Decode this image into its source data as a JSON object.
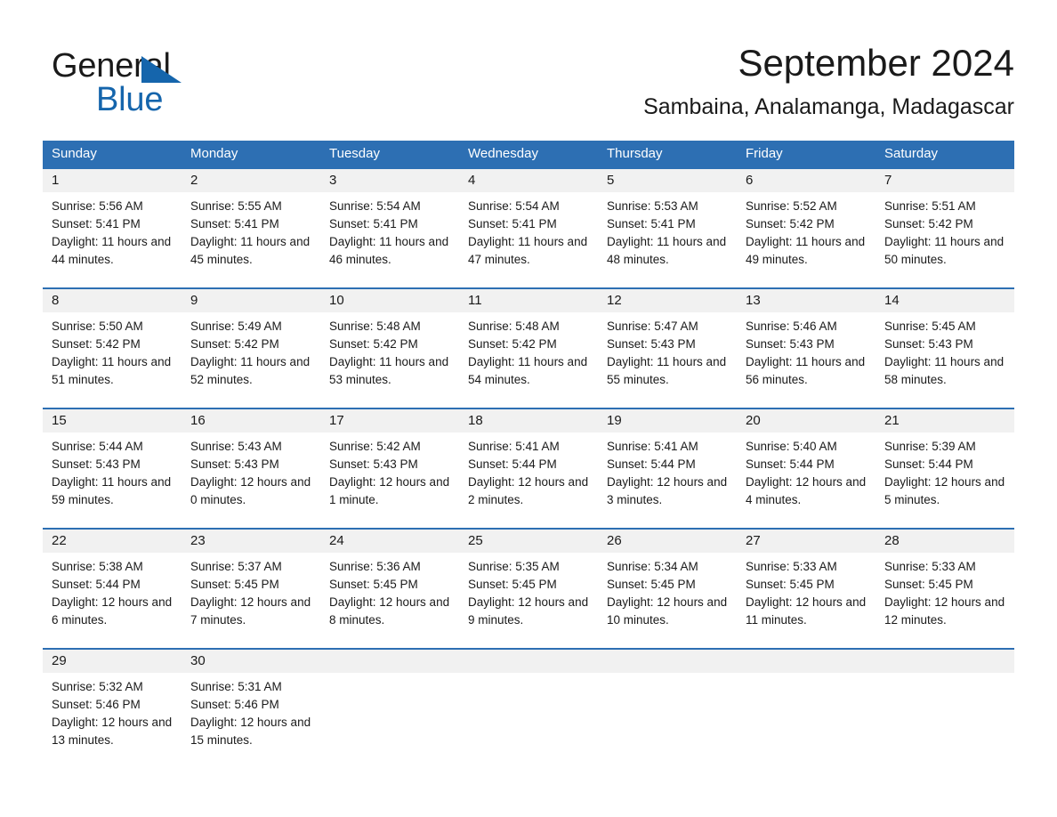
{
  "brand": {
    "name_dark": "General",
    "name_blue": "Blue",
    "logo_color": "#1565ac"
  },
  "header": {
    "title": "September 2024",
    "subtitle": "Sambaina, Analamanga, Madagascar"
  },
  "theme": {
    "accent": "#2d6fb3",
    "daynum_band": "#f1f1f1",
    "text": "#1a1a1a"
  },
  "weekdays": [
    "Sunday",
    "Monday",
    "Tuesday",
    "Wednesday",
    "Thursday",
    "Friday",
    "Saturday"
  ],
  "weeks": [
    [
      {
        "day": "1",
        "sunrise": "Sunrise: 5:56 AM",
        "sunset": "Sunset: 5:41 PM",
        "daylight": "Daylight: 11 hours and 44 minutes."
      },
      {
        "day": "2",
        "sunrise": "Sunrise: 5:55 AM",
        "sunset": "Sunset: 5:41 PM",
        "daylight": "Daylight: 11 hours and 45 minutes."
      },
      {
        "day": "3",
        "sunrise": "Sunrise: 5:54 AM",
        "sunset": "Sunset: 5:41 PM",
        "daylight": "Daylight: 11 hours and 46 minutes."
      },
      {
        "day": "4",
        "sunrise": "Sunrise: 5:54 AM",
        "sunset": "Sunset: 5:41 PM",
        "daylight": "Daylight: 11 hours and 47 minutes."
      },
      {
        "day": "5",
        "sunrise": "Sunrise: 5:53 AM",
        "sunset": "Sunset: 5:41 PM",
        "daylight": "Daylight: 11 hours and 48 minutes."
      },
      {
        "day": "6",
        "sunrise": "Sunrise: 5:52 AM",
        "sunset": "Sunset: 5:42 PM",
        "daylight": "Daylight: 11 hours and 49 minutes."
      },
      {
        "day": "7",
        "sunrise": "Sunrise: 5:51 AM",
        "sunset": "Sunset: 5:42 PM",
        "daylight": "Daylight: 11 hours and 50 minutes."
      }
    ],
    [
      {
        "day": "8",
        "sunrise": "Sunrise: 5:50 AM",
        "sunset": "Sunset: 5:42 PM",
        "daylight": "Daylight: 11 hours and 51 minutes."
      },
      {
        "day": "9",
        "sunrise": "Sunrise: 5:49 AM",
        "sunset": "Sunset: 5:42 PM",
        "daylight": "Daylight: 11 hours and 52 minutes."
      },
      {
        "day": "10",
        "sunrise": "Sunrise: 5:48 AM",
        "sunset": "Sunset: 5:42 PM",
        "daylight": "Daylight: 11 hours and 53 minutes."
      },
      {
        "day": "11",
        "sunrise": "Sunrise: 5:48 AM",
        "sunset": "Sunset: 5:42 PM",
        "daylight": "Daylight: 11 hours and 54 minutes."
      },
      {
        "day": "12",
        "sunrise": "Sunrise: 5:47 AM",
        "sunset": "Sunset: 5:43 PM",
        "daylight": "Daylight: 11 hours and 55 minutes."
      },
      {
        "day": "13",
        "sunrise": "Sunrise: 5:46 AM",
        "sunset": "Sunset: 5:43 PM",
        "daylight": "Daylight: 11 hours and 56 minutes."
      },
      {
        "day": "14",
        "sunrise": "Sunrise: 5:45 AM",
        "sunset": "Sunset: 5:43 PM",
        "daylight": "Daylight: 11 hours and 58 minutes."
      }
    ],
    [
      {
        "day": "15",
        "sunrise": "Sunrise: 5:44 AM",
        "sunset": "Sunset: 5:43 PM",
        "daylight": "Daylight: 11 hours and 59 minutes."
      },
      {
        "day": "16",
        "sunrise": "Sunrise: 5:43 AM",
        "sunset": "Sunset: 5:43 PM",
        "daylight": "Daylight: 12 hours and 0 minutes."
      },
      {
        "day": "17",
        "sunrise": "Sunrise: 5:42 AM",
        "sunset": "Sunset: 5:43 PM",
        "daylight": "Daylight: 12 hours and 1 minute."
      },
      {
        "day": "18",
        "sunrise": "Sunrise: 5:41 AM",
        "sunset": "Sunset: 5:44 PM",
        "daylight": "Daylight: 12 hours and 2 minutes."
      },
      {
        "day": "19",
        "sunrise": "Sunrise: 5:41 AM",
        "sunset": "Sunset: 5:44 PM",
        "daylight": "Daylight: 12 hours and 3 minutes."
      },
      {
        "day": "20",
        "sunrise": "Sunrise: 5:40 AM",
        "sunset": "Sunset: 5:44 PM",
        "daylight": "Daylight: 12 hours and 4 minutes."
      },
      {
        "day": "21",
        "sunrise": "Sunrise: 5:39 AM",
        "sunset": "Sunset: 5:44 PM",
        "daylight": "Daylight: 12 hours and 5 minutes."
      }
    ],
    [
      {
        "day": "22",
        "sunrise": "Sunrise: 5:38 AM",
        "sunset": "Sunset: 5:44 PM",
        "daylight": "Daylight: 12 hours and 6 minutes."
      },
      {
        "day": "23",
        "sunrise": "Sunrise: 5:37 AM",
        "sunset": "Sunset: 5:45 PM",
        "daylight": "Daylight: 12 hours and 7 minutes."
      },
      {
        "day": "24",
        "sunrise": "Sunrise: 5:36 AM",
        "sunset": "Sunset: 5:45 PM",
        "daylight": "Daylight: 12 hours and 8 minutes."
      },
      {
        "day": "25",
        "sunrise": "Sunrise: 5:35 AM",
        "sunset": "Sunset: 5:45 PM",
        "daylight": "Daylight: 12 hours and 9 minutes."
      },
      {
        "day": "26",
        "sunrise": "Sunrise: 5:34 AM",
        "sunset": "Sunset: 5:45 PM",
        "daylight": "Daylight: 12 hours and 10 minutes."
      },
      {
        "day": "27",
        "sunrise": "Sunrise: 5:33 AM",
        "sunset": "Sunset: 5:45 PM",
        "daylight": "Daylight: 12 hours and 11 minutes."
      },
      {
        "day": "28",
        "sunrise": "Sunrise: 5:33 AM",
        "sunset": "Sunset: 5:45 PM",
        "daylight": "Daylight: 12 hours and 12 minutes."
      }
    ],
    [
      {
        "day": "29",
        "sunrise": "Sunrise: 5:32 AM",
        "sunset": "Sunset: 5:46 PM",
        "daylight": "Daylight: 12 hours and 13 minutes."
      },
      {
        "day": "30",
        "sunrise": "Sunrise: 5:31 AM",
        "sunset": "Sunset: 5:46 PM",
        "daylight": "Daylight: 12 hours and 15 minutes."
      },
      {
        "day": "",
        "sunrise": "",
        "sunset": "",
        "daylight": ""
      },
      {
        "day": "",
        "sunrise": "",
        "sunset": "",
        "daylight": ""
      },
      {
        "day": "",
        "sunrise": "",
        "sunset": "",
        "daylight": ""
      },
      {
        "day": "",
        "sunrise": "",
        "sunset": "",
        "daylight": ""
      },
      {
        "day": "",
        "sunrise": "",
        "sunset": "",
        "daylight": ""
      }
    ]
  ]
}
